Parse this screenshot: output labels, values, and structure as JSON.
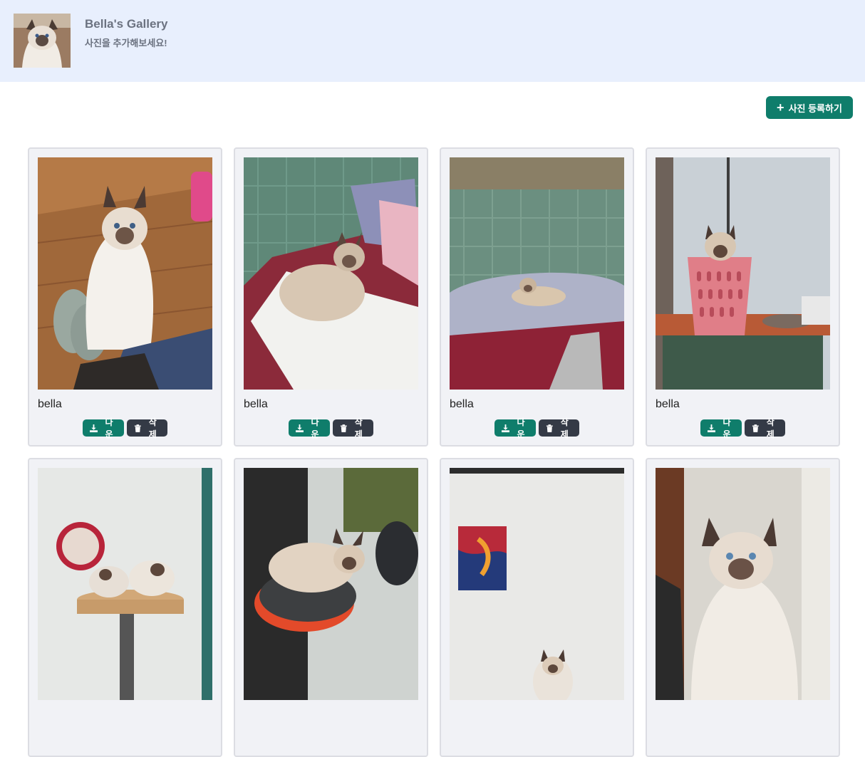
{
  "header": {
    "title": "Bella's Gallery",
    "subtitle": "사진을 추가해보세요!"
  },
  "toolbar": {
    "add_label": "사진 등록하기"
  },
  "cards": [
    {
      "caption": "bella",
      "download_label": "다운",
      "delete_label": "삭제",
      "scene": "cat-wood-floor"
    },
    {
      "caption": "bella",
      "download_label": "다운",
      "delete_label": "삭제",
      "scene": "cat-on-bed"
    },
    {
      "caption": "bella",
      "download_label": "다운",
      "delete_label": "삭제",
      "scene": "cat-on-blanket"
    },
    {
      "caption": "bella",
      "download_label": "다운",
      "delete_label": "삭제",
      "scene": "cat-in-basket"
    },
    {
      "caption": "",
      "download_label": "",
      "delete_label": "",
      "scene": "two-cats-on-shelf"
    },
    {
      "caption": "",
      "download_label": "",
      "delete_label": "",
      "scene": "cat-on-chair"
    },
    {
      "caption": "",
      "download_label": "",
      "delete_label": "",
      "scene": "cat-by-painting"
    },
    {
      "caption": "",
      "download_label": "",
      "delete_label": "",
      "scene": "cat-closeup"
    }
  ],
  "colors": {
    "header_bg": "#e8effd",
    "accent": "#0f7d6b",
    "delete": "#343a46"
  },
  "icons": [
    "plus-icon",
    "download-icon",
    "trash-icon"
  ]
}
